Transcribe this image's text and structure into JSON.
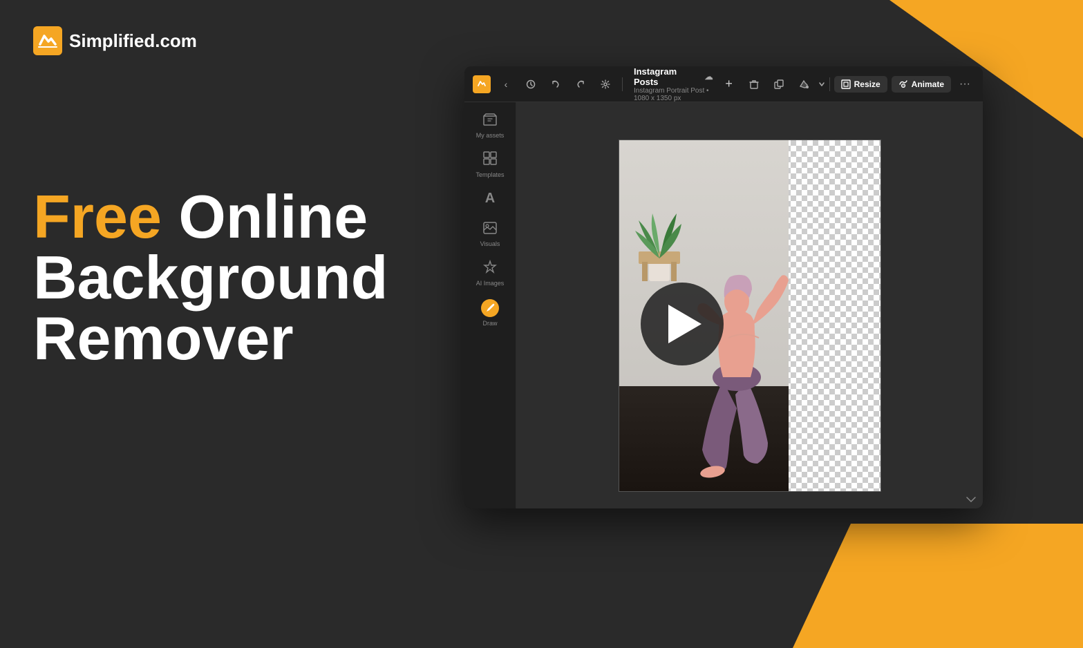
{
  "brand": {
    "logo_text": "Simplified.com",
    "logo_icon": "⚡"
  },
  "headline": {
    "line1_free": "Free",
    "line1_rest": " Online",
    "line2": "Background",
    "line3": "Remover"
  },
  "app": {
    "project_title": "Instagram Posts",
    "project_subtitle": "Instagram Portrait Post • 1080 x 1350 px",
    "toolbar": {
      "back": "‹",
      "history": "🕐",
      "undo": "↩",
      "redo": "↪",
      "settings": "⚙",
      "add": "+",
      "delete": "🗑",
      "copy": "⧉",
      "fill": "🪣",
      "resize_label": "Resize",
      "animate_label": "Animate",
      "more": "···"
    },
    "sidebar": [
      {
        "icon": "📁",
        "label": "My assets"
      },
      {
        "icon": "⊞",
        "label": "Templates"
      },
      {
        "icon": "A",
        "label": ""
      },
      {
        "icon": "🖼",
        "label": "Visuals"
      },
      {
        "icon": "✨",
        "label": "AI Images"
      },
      {
        "icon": "✏️",
        "label": "Draw"
      }
    ]
  },
  "colors": {
    "orange": "#f5a623",
    "dark_bg": "#2a2a2a",
    "app_bg": "#1a1a1a",
    "sidebar_bg": "#1e1e1e"
  }
}
